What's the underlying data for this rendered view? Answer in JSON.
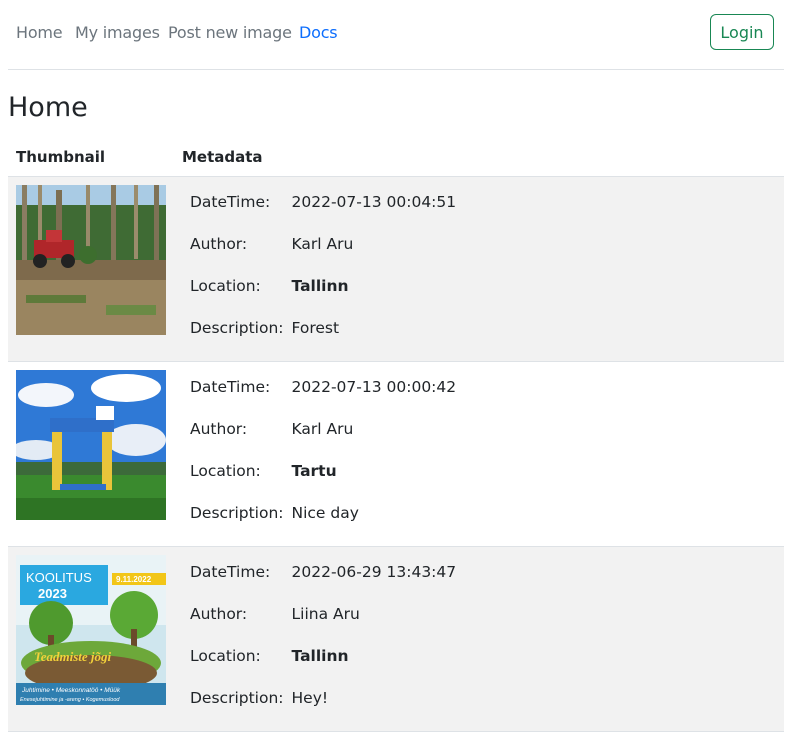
{
  "nav": {
    "items": [
      "Home",
      "My images",
      "Post new image",
      "Docs"
    ],
    "login": "Login"
  },
  "page": {
    "title": "Home"
  },
  "table": {
    "headers": [
      "Thumbnail",
      "Metadata"
    ],
    "labels": {
      "datetime": "DateTime:",
      "author": "Author:",
      "location": "Location:",
      "description": "Description:"
    },
    "rows": [
      {
        "datetime": "2022-07-13 00:04:51",
        "author": "Karl Aru",
        "location": "Tallinn",
        "description": "Forest"
      },
      {
        "datetime": "2022-07-13 00:00:42",
        "author": "Karl Aru",
        "location": "Tartu",
        "description": "Nice day"
      },
      {
        "datetime": "2022-06-29 13:43:47",
        "author": "Liina Aru",
        "location": "Tallinn",
        "description": "Hey!"
      }
    ]
  },
  "poster": {
    "brand": "KOOLITUS",
    "year": "2023",
    "date": "9.11.2022",
    "title": "Teadmiste jõgi",
    "tagline1": "Juhtimine • Meeskonnatöö • Müük",
    "tagline2": "Enesejuhtimine ja -areng • Kogemuslood"
  },
  "colors": {
    "link": "#0d6efd",
    "login": "#198754",
    "row_stripe": "#f2f2f2"
  }
}
